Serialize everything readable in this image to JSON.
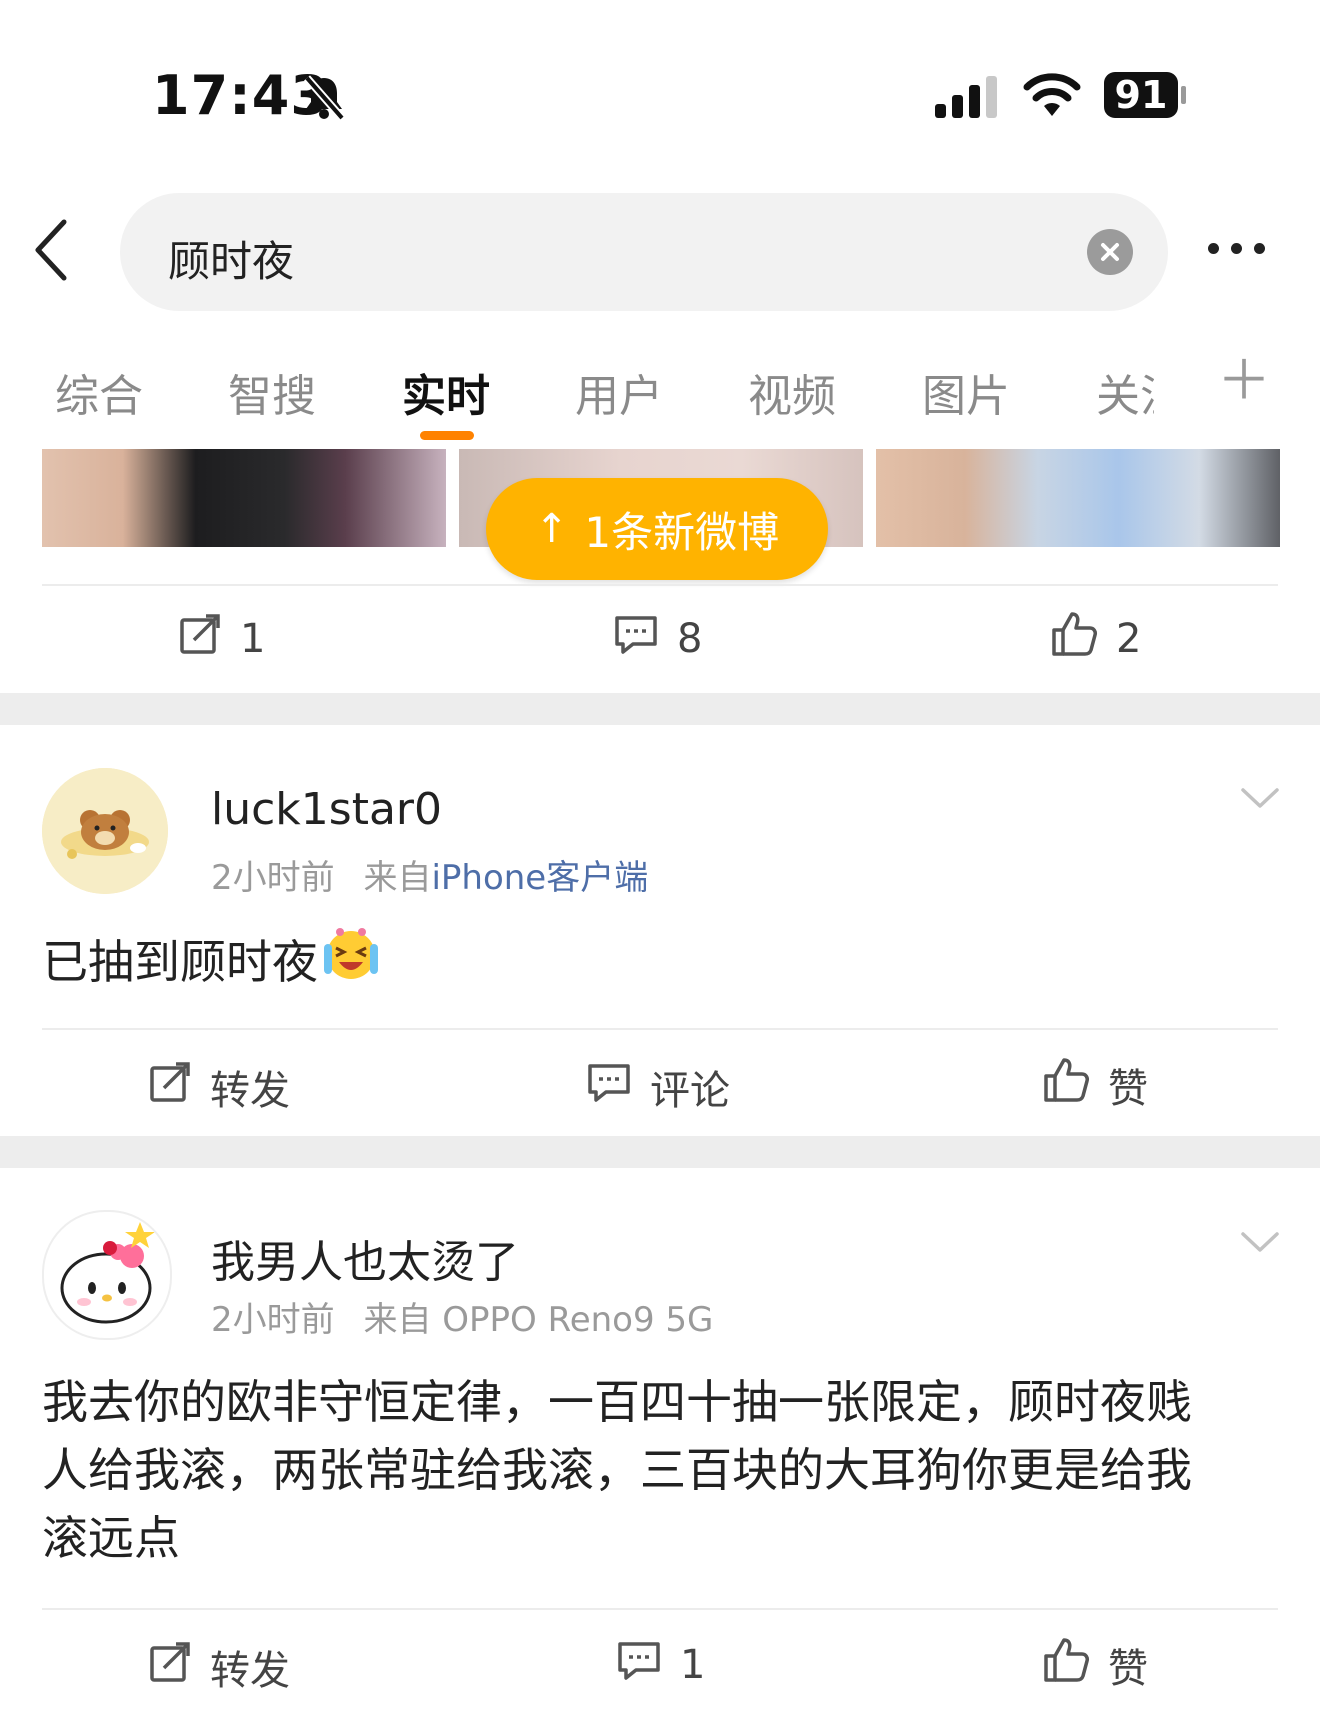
{
  "status_bar": {
    "time": "17:43",
    "battery": "91"
  },
  "search": {
    "query": "顾时夜"
  },
  "tabs": [
    "综合",
    "智搜",
    "实时",
    "用户",
    "视频",
    "图片",
    "关注"
  ],
  "active_tab": "实时",
  "new_posts_banner": "1条新微博",
  "prev_post": {
    "reposts": "1",
    "comments": "8",
    "likes": "2"
  },
  "posts": [
    {
      "username": "luck1star0",
      "time": "2小时前",
      "source_prefix": "来自",
      "source": "iPhone客户端",
      "text": "已抽到顾时夜",
      "repost_label": "转发",
      "comment_label": "评论",
      "like_label": "赞"
    },
    {
      "username": "我男人也太烫了",
      "time": "2小时前",
      "source_prefix": "来自",
      "source": "OPPO Reno9 5G",
      "text_lines": [
        "我去你的欧非守恒定律，一百四十抽一张限定，顾时夜贱",
        "人给我滚，两张常驻给我滚，三百块的大耳狗你更是给我",
        "滚远点"
      ],
      "repost_label": "转发",
      "comments": "1",
      "like_label": "赞"
    }
  ],
  "colors": {
    "accent": "#ff8200",
    "banner": "#ffb300",
    "link": "#4e6ea8"
  },
  "icons": [
    "bell-muted-icon",
    "signal-icon",
    "wifi-icon",
    "back-icon",
    "clear-icon",
    "more-icon",
    "plus-icon",
    "repost-icon",
    "comment-icon",
    "like-icon",
    "chevron-down-icon",
    "crying-laugh-emoji-icon"
  ]
}
